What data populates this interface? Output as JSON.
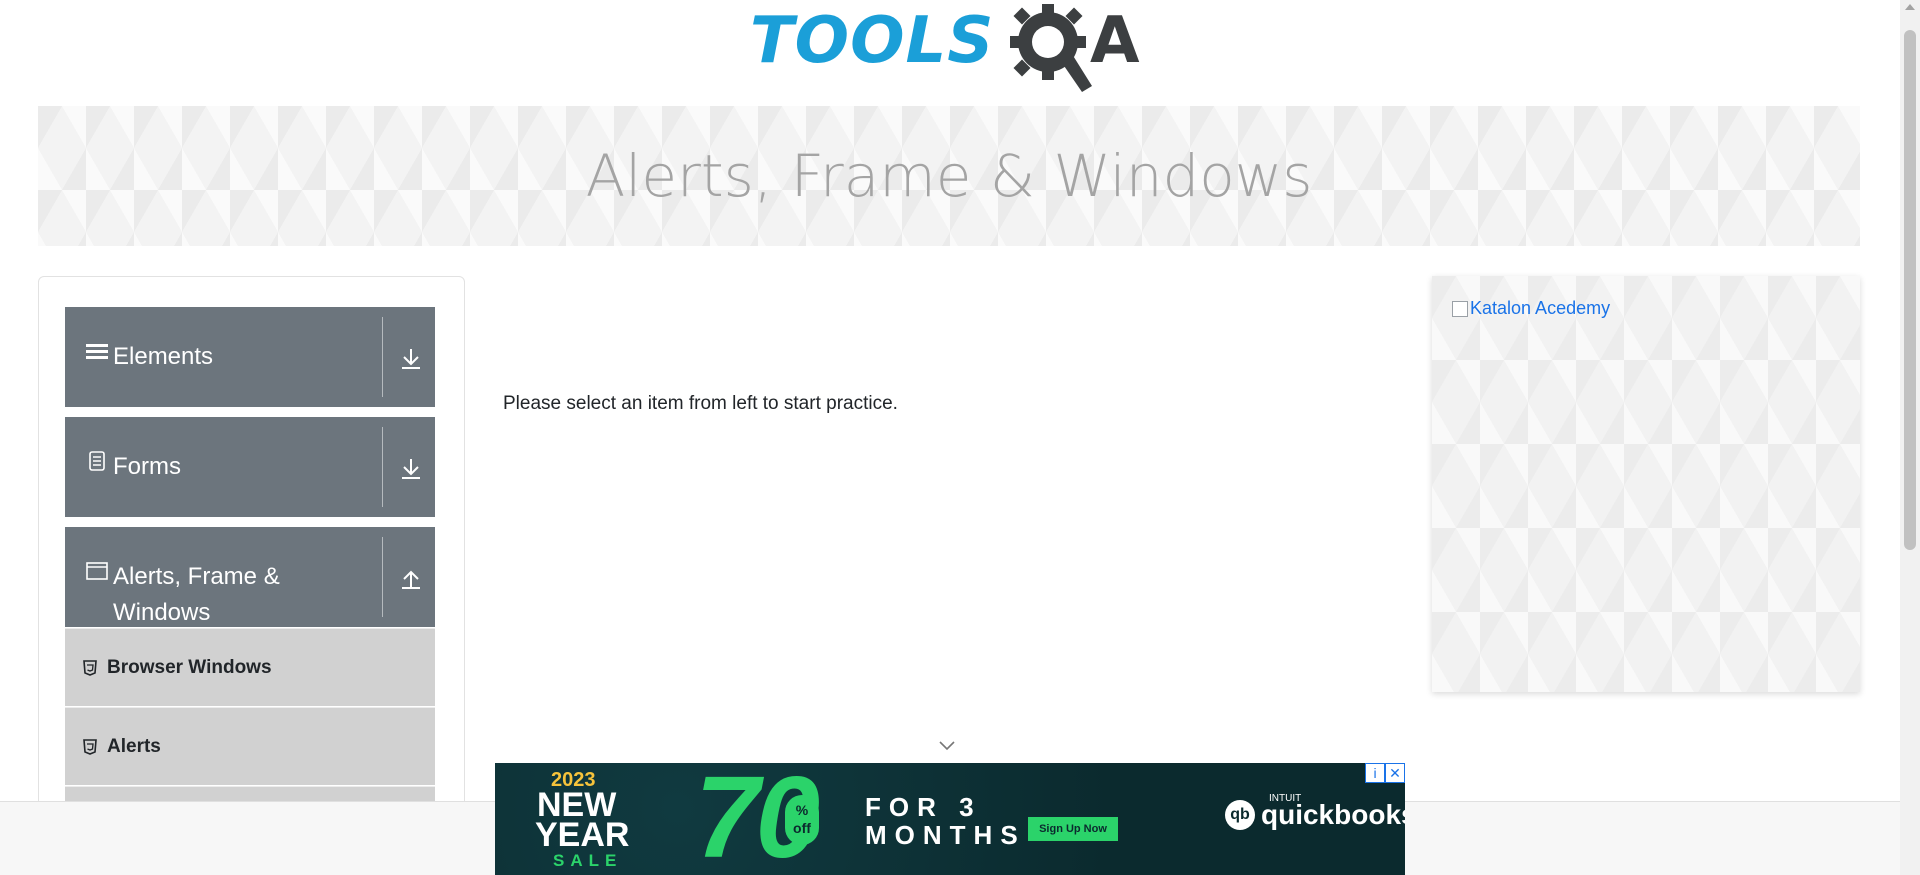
{
  "header": {
    "logo_text_tools": "TOOLS",
    "logo_text_a": "A"
  },
  "banner": {
    "title": "Alerts, Frame & Windows"
  },
  "sidebar": {
    "groups": [
      {
        "label": "Elements",
        "icon": "hamburger-icon",
        "state": "collapsed",
        "arrow": "download-icon"
      },
      {
        "label": "Forms",
        "icon": "document-icon",
        "state": "collapsed",
        "arrow": "download-icon"
      },
      {
        "label": "Alerts, Frame & Windows",
        "icon": "window-icon",
        "state": "expanded",
        "arrow": "upload-icon"
      }
    ],
    "items": [
      {
        "label": "Browser Windows",
        "icon": "html5-icon"
      },
      {
        "label": "Alerts",
        "icon": "html5-icon"
      },
      {
        "label": "",
        "icon": "html5-icon"
      }
    ]
  },
  "main": {
    "message": "Please select an item from left to start practice."
  },
  "right_ad": {
    "alt_text": "Katalon Acedemy"
  },
  "ad": {
    "year": "2023",
    "line1": "NEW",
    "line2": "YEAR",
    "sale": "SALE",
    "big_number": "70",
    "pct_symbol": "%",
    "pct_off": "off",
    "offer_line1": "FOR 3",
    "offer_line2": "MONTHS",
    "cta": "Sign Up Now",
    "brand_small": "INTUIT",
    "brand": "quickbooks",
    "brand_badge": "qb",
    "info_icon": "i",
    "close_icon": "✕"
  },
  "colors": {
    "accent_blue": "#1b9fd8",
    "sidebar_header": "#6c757d",
    "sidebar_item": "#d1d1d1",
    "ad_green": "#2bd36a",
    "ad_bg": "#0b2a2e"
  }
}
